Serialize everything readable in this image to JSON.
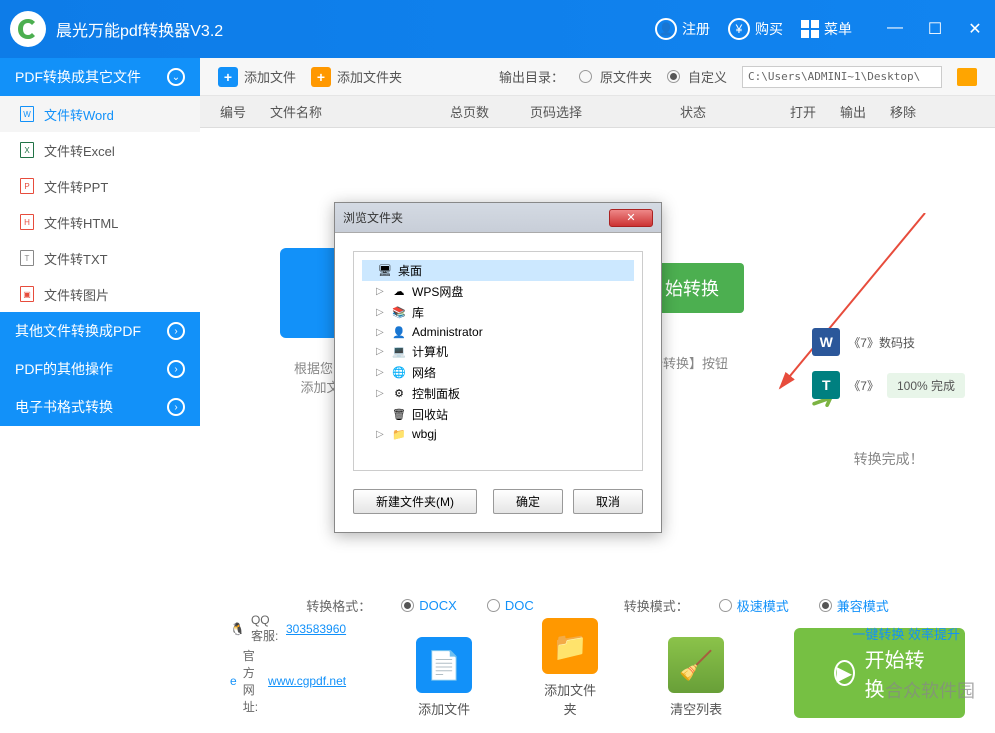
{
  "title_bar": {
    "app_title": "晨光万能pdf转换器V3.2",
    "register": "注册",
    "buy": "购买",
    "menu": "菜单"
  },
  "sidebar": {
    "group1": "PDF转换成其它文件",
    "items": [
      "文件转Word",
      "文件转Excel",
      "文件转PPT",
      "文件转HTML",
      "文件转TXT",
      "文件转图片"
    ],
    "group2": "其他文件转换成PDF",
    "group3": "PDF的其他操作",
    "group4": "电子书格式转换"
  },
  "toolbar": {
    "add_file": "添加文件",
    "add_folder": "添加文件夹",
    "output_dir": "输出目录：",
    "original": "原文件夹",
    "custom": "自定义",
    "path": "C:\\Users\\ADMINI~1\\Desktop\\"
  },
  "table": {
    "col1": "编号",
    "col2": "文件名称",
    "col3": "总页数",
    "col4": "页码选择",
    "col5": "状态",
    "col6": "打开",
    "col7": "输出",
    "col8": "移除"
  },
  "canvas": {
    "placeholder_line1": "根据您的",
    "placeholder_line2": "添加文",
    "start_btn": "始转换",
    "tip": "始转换】按钮",
    "result1": "《7》数码技",
    "result2": "《7》",
    "progress": "100%  完成",
    "done": "转换完成！"
  },
  "dialog": {
    "title": "浏览文件夹",
    "tree": {
      "desktop": "桌面",
      "wps": "WPS网盘",
      "lib": "库",
      "admin": "Administrator",
      "computer": "计算机",
      "network": "网络",
      "control": "控制面板",
      "recycle": "回收站",
      "wbgj": "wbgj"
    },
    "new_folder": "新建文件夹(M)",
    "ok": "确定",
    "cancel": "取消"
  },
  "format_bar": {
    "format_label": "转换格式：",
    "docx": "DOCX",
    "doc": "DOC",
    "mode_label": "转换模式：",
    "fast": "极速模式",
    "compat": "兼容模式"
  },
  "bottom": {
    "qq_label": "QQ 客服:",
    "qq": "303583960",
    "site_label": "官方网址:",
    "site": "www.cgpdf.net",
    "add_file": "添加文件",
    "add_folder": "添加文件夹",
    "clear": "清空列表",
    "start": "开始转换",
    "link": "一键转换  效率提升",
    "watermark": "合众软件园"
  }
}
